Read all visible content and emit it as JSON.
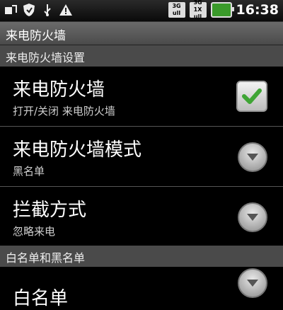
{
  "status_bar": {
    "icons": [
      "usb-debug-icon",
      "shield-icon",
      "usb-icon",
      "warning-icon"
    ],
    "network_badges": [
      {
        "line1": "3G",
        "line2": "ull"
      },
      {
        "line1": "3G 1X",
        "line2": "ull"
      }
    ],
    "time": "16:38"
  },
  "title_bar": {
    "title": "来电防火墙"
  },
  "sections": {
    "firewall_settings": "来电防火墙设置",
    "lists": "白名单和黑名单"
  },
  "preferences": [
    {
      "title": "来电防火墙",
      "summary": "打开/关闭 来电防火墙",
      "control": "checkbox",
      "checked": true
    },
    {
      "title": "来电防火墙模式",
      "summary": "黑名单",
      "control": "dropdown"
    },
    {
      "title": "拦截方式",
      "summary": "忽略来电",
      "control": "dropdown"
    },
    {
      "title": "白名单",
      "summary": "",
      "control": "dropdown"
    }
  ],
  "colors": {
    "check_green": "#3fa535",
    "section_bg": "#4a4a4a",
    "title_bg": "#5a5a5a"
  }
}
